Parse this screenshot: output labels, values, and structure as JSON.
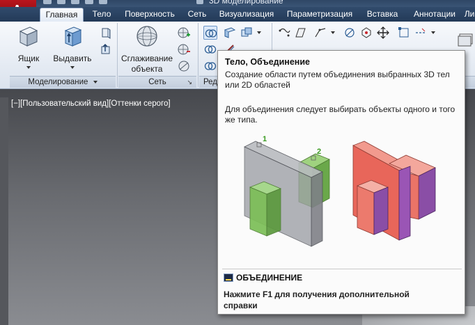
{
  "window": {
    "title": "3D моделирование"
  },
  "tabs": [
    "Главная",
    "Тело",
    "Поверхность",
    "Сеть",
    "Визуализация",
    "Параметризация",
    "Вставка",
    "Аннотации",
    "Ли"
  ],
  "ribbon": {
    "buttons": {
      "box": "Ящик",
      "extrude": "Выдавить",
      "smooth_line1": "Сглаживание",
      "smooth_line2": "объекта"
    },
    "panels": {
      "modeling": "Моделирование",
      "mesh": "Сеть",
      "edit_partial": "Ред"
    }
  },
  "viewport": {
    "label": "[−][Пользовательский вид][Оттенки серого]"
  },
  "tooltip": {
    "title": "Тело, Объединение",
    "description": "Создание области путем объединения выбранных 3D тел или 2D областей",
    "note": "Для объединения следует выбирать объекты одного и того же типа.",
    "label_1": "1",
    "label_2": "2",
    "command": "ОБЪЕДИНЕНИЕ",
    "help": "Нажмите F1 для получения дополнительной справки"
  },
  "colors": {
    "accent": "#cf1720",
    "ribbon_bg": "#e5ebf3",
    "tab_bar": "#2a4263",
    "illus_gray": "#8d8f96",
    "illus_green": "#7cbf57",
    "illus_red": "#e8665a",
    "illus_purple": "#8a4ea6",
    "label_green": "#3a9a20"
  }
}
